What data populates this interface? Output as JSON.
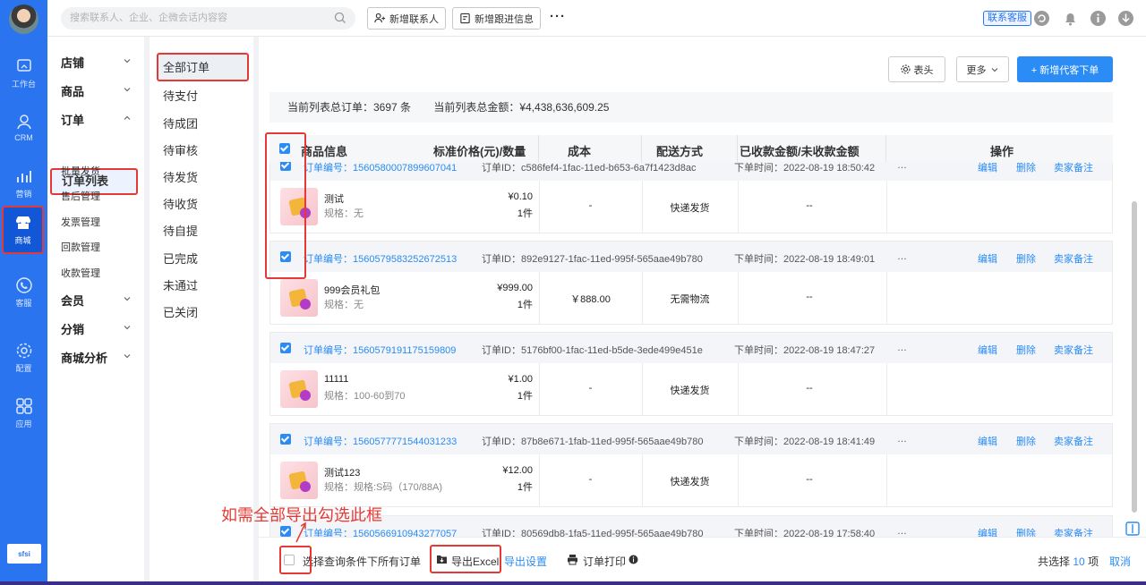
{
  "leftbar": {
    "items": [
      {
        "label": "工作台",
        "icon": "dashboard-icon"
      },
      {
        "label": "CRM",
        "icon": "person-icon"
      },
      {
        "label": "营销",
        "icon": "chart-icon"
      },
      {
        "label": "商城",
        "icon": "store-icon"
      },
      {
        "label": "客服",
        "icon": "phone-icon"
      },
      {
        "label": "配置",
        "icon": "gear-icon"
      },
      {
        "label": "应用",
        "icon": "apps-icon"
      }
    ],
    "logo_text": "sfsi"
  },
  "topbar": {
    "search_placeholder": "搜索联系人、企业、企微会话内容容",
    "add_contact": "新增联系人",
    "add_followup": "新增跟进信息",
    "more": "···",
    "customer_service": "联系客服"
  },
  "submenu": {
    "groups": [
      {
        "label": "店铺"
      },
      {
        "label": "商品"
      },
      {
        "label": "订单"
      },
      {
        "label": "会员"
      },
      {
        "label": "分销"
      },
      {
        "label": "商城分析"
      }
    ],
    "order_items": [
      "订单列表",
      "批量发货",
      "售后管理",
      "发票管理",
      "回款管理",
      "收款管理"
    ]
  },
  "status_tabs": [
    "全部订单",
    "待支付",
    "待成团",
    "待审核",
    "待发货",
    "待收货",
    "待自提",
    "已完成",
    "未通过",
    "已关闭"
  ],
  "toolbar": {
    "columns_btn": "表头",
    "more_btn": "更多",
    "add_order_btn": "+ 新增代客下单"
  },
  "summary": {
    "total_orders": "当前列表总订单：3697 条",
    "total_amount": "当前列表总金额：¥4,438,636,609.25"
  },
  "table_headers": {
    "product": "商品信息",
    "price_qty": "标准价格(元)/数量",
    "cost": "成本",
    "shipping": "配送方式",
    "paid_unpaid": "已收款金额/未收款金额",
    "ops": "操作"
  },
  "actions": {
    "edit": "编辑",
    "delete": "删除",
    "remark": "卖家备注"
  },
  "orders": [
    {
      "no": "订单编号：1560580007899607041",
      "id": "订单ID：c586fef4-1fac-11ed-b653-6a7f1423d8ac",
      "time": "下单时间：2022-08-19 18:50:42",
      "more": "…",
      "name": "测试",
      "spec": "规格：无",
      "price": "¥0.10",
      "qty": "1件",
      "cost": "-",
      "ship": "快递发货",
      "paid": "--"
    },
    {
      "no": "订单编号：1560579583252672513",
      "id": "订单ID：892e9127-1fac-11ed-995f-565aae49b780",
      "time": "下单时间：2022-08-19 18:49:01",
      "more": "…",
      "name": "999会员礼包",
      "spec": "规格：无",
      "price": "¥999.00",
      "qty": "1件",
      "cost": "￥888.00",
      "ship": "无需物流",
      "paid": "--"
    },
    {
      "no": "订单编号：1560579191175159809",
      "id": "订单ID：5176bf00-1fac-11ed-b5de-3ede499e451e",
      "time": "下单时间：2022-08-19 18:47:27",
      "more": "…",
      "name": "11111",
      "spec": "规格：100-60到70",
      "price": "¥1.00",
      "qty": "1件",
      "cost": "-",
      "ship": "快递发货",
      "paid": "--"
    },
    {
      "no": "订单编号：1560577771544031233",
      "id": "订单ID：87b8e671-1fab-11ed-995f-565aae49b780",
      "time": "下单时间：2022-08-19 18:41:49",
      "more": "…",
      "name": "测试123",
      "spec": "规格：规格:S码（170/88A)",
      "price": "¥12.00",
      "qty": "1件",
      "cost": "-",
      "ship": "快递发货",
      "paid": "--"
    },
    {
      "no": "订单编号：1560566910943277057",
      "id": "订单ID：80569db8-1fa5-11ed-995f-565aae49b780",
      "time": "下单时间：2022-08-19 17:58:40",
      "more": "…"
    }
  ],
  "footer": {
    "select_all_label": "选择查询条件下所有订单",
    "export_excel": "导出Excel",
    "export_settings": "导出设置",
    "print_orders": "订单打印",
    "selected_prefix": "共选择",
    "selected_count": "10",
    "selected_suffix": "项",
    "cancel": "取消"
  },
  "annotation": "如需全部导出勾选此框",
  "colors": {
    "primary": "#2a74f0",
    "link": "#2a8cf4",
    "highlight": "#e53935"
  }
}
